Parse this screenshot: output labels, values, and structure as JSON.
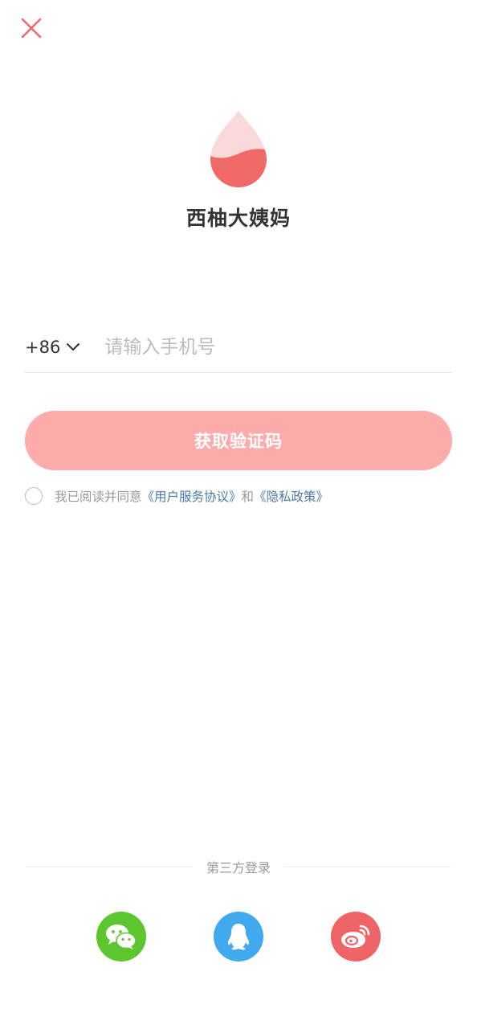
{
  "app": {
    "name": "西柚大姨妈"
  },
  "phone": {
    "country_code": "+86",
    "placeholder": "请输入手机号",
    "value": ""
  },
  "actions": {
    "get_code_label": "获取验证码"
  },
  "agreement": {
    "prefix": "我已阅读并同意",
    "terms_link": "《用户服务协议》",
    "conjunction": "和",
    "privacy_link": "《隐私政策》",
    "checked": false
  },
  "third_party": {
    "label": "第三方登录",
    "providers": [
      {
        "name": "wechat",
        "icon": "wechat-icon",
        "color": "#5cc62f"
      },
      {
        "name": "qq",
        "icon": "qq-icon",
        "color": "#41a9ee"
      },
      {
        "name": "weibo",
        "icon": "weibo-icon",
        "color": "#ef6467"
      }
    ]
  },
  "colors": {
    "accent": "#f06868",
    "button": "#feabab",
    "link": "#4f7aa6"
  }
}
